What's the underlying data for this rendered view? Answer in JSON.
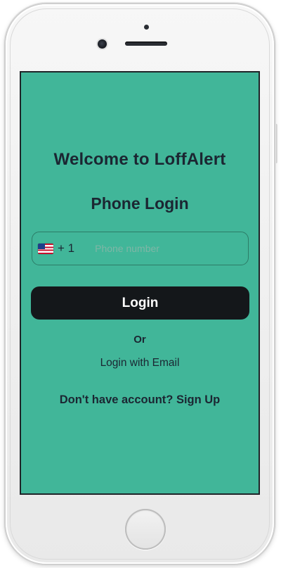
{
  "screen": {
    "background_color": "#41b699",
    "welcome_title": "Welcome to LoffAlert",
    "subtitle": "Phone Login"
  },
  "phone_field": {
    "country_flag_icon": "us-flag-icon",
    "country_code": "+ 1",
    "placeholder": "Phone number",
    "value": ""
  },
  "login_button": {
    "label": "Login",
    "background_color": "#14171a"
  },
  "divider_text": "Or",
  "email_login_link": "Login with Email",
  "signup": {
    "prompt": "Don't have account?",
    "link_label": "Sign Up"
  }
}
